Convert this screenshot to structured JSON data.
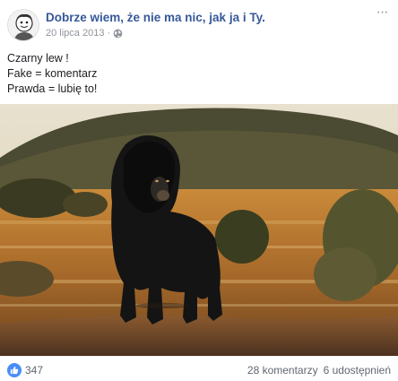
{
  "post": {
    "page_name": "Dobrze wiem, że nie ma nic, jak ja i Ty.",
    "date": "20 lipca 2013",
    "separator": "·",
    "more_label": "···",
    "privacy_icon": "globe-icon",
    "text_lines": [
      "Czarny lew !",
      "Fake = komentarz",
      "Prawda = lubię to!"
    ],
    "photo_subject": "black-lion-photo"
  },
  "footer": {
    "like_icon": "thumbs-up-icon",
    "like_count": "347",
    "comments": "28 komentarzy",
    "shares": "6 udostępnień"
  },
  "colors": {
    "link": "#365899",
    "meta": "#90949c",
    "like_blue": "#4a8cf7"
  }
}
